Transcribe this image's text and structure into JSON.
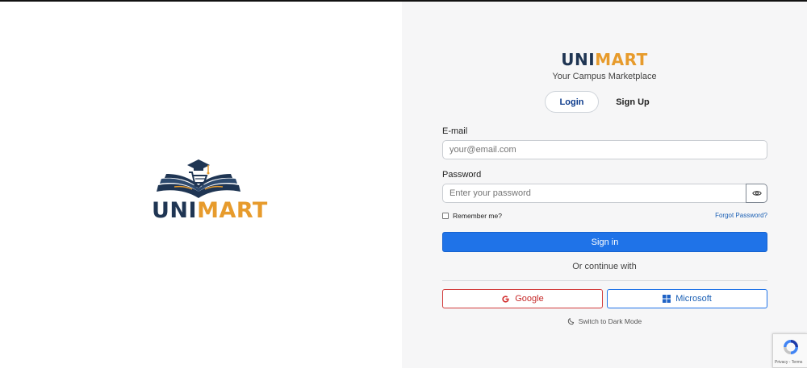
{
  "logo": {
    "part1": "UNI",
    "part2": "MART",
    "icon": "book-cart-graduation-cap-icon"
  },
  "brand": {
    "part1": "UNI",
    "part2": "MART",
    "tagline": "Your Campus Marketplace"
  },
  "tabs": {
    "login": "Login",
    "signup": "Sign Up",
    "active": "login"
  },
  "form": {
    "email_label": "E-mail",
    "email_placeholder": "your@email.com",
    "password_label": "Password",
    "password_placeholder": "Enter your password",
    "remember_label": "Remember me?",
    "remember_checked": false,
    "forgot_label": "Forgot Password?",
    "signin_label": "Sign in"
  },
  "alt": {
    "continue_text": "Or continue with",
    "google_label": "Google",
    "microsoft_label": "Microsoft"
  },
  "darkmode_label": "Switch to Dark Mode",
  "recaptcha": {
    "links": "Privacy - Terms"
  },
  "colors": {
    "navy": "#1f3553",
    "orange": "#e79b2c",
    "primary": "#1f73e8",
    "google_red": "#c62828",
    "panel_bg": "#f6f6f7"
  }
}
